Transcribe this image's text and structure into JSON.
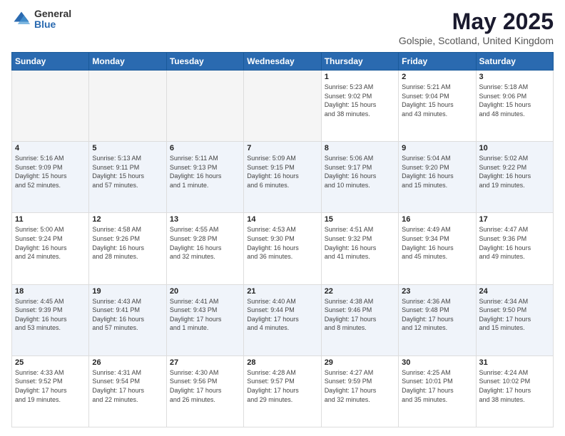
{
  "logo": {
    "general": "General",
    "blue": "Blue"
  },
  "header": {
    "title": "May 2025",
    "subtitle": "Golspie, Scotland, United Kingdom"
  },
  "days_of_week": [
    "Sunday",
    "Monday",
    "Tuesday",
    "Wednesday",
    "Thursday",
    "Friday",
    "Saturday"
  ],
  "weeks": [
    [
      {
        "day": "",
        "info": ""
      },
      {
        "day": "",
        "info": ""
      },
      {
        "day": "",
        "info": ""
      },
      {
        "day": "",
        "info": ""
      },
      {
        "day": "1",
        "info": "Sunrise: 5:23 AM\nSunset: 9:02 PM\nDaylight: 15 hours\nand 38 minutes."
      },
      {
        "day": "2",
        "info": "Sunrise: 5:21 AM\nSunset: 9:04 PM\nDaylight: 15 hours\nand 43 minutes."
      },
      {
        "day": "3",
        "info": "Sunrise: 5:18 AM\nSunset: 9:06 PM\nDaylight: 15 hours\nand 48 minutes."
      }
    ],
    [
      {
        "day": "4",
        "info": "Sunrise: 5:16 AM\nSunset: 9:09 PM\nDaylight: 15 hours\nand 52 minutes."
      },
      {
        "day": "5",
        "info": "Sunrise: 5:13 AM\nSunset: 9:11 PM\nDaylight: 15 hours\nand 57 minutes."
      },
      {
        "day": "6",
        "info": "Sunrise: 5:11 AM\nSunset: 9:13 PM\nDaylight: 16 hours\nand 1 minute."
      },
      {
        "day": "7",
        "info": "Sunrise: 5:09 AM\nSunset: 9:15 PM\nDaylight: 16 hours\nand 6 minutes."
      },
      {
        "day": "8",
        "info": "Sunrise: 5:06 AM\nSunset: 9:17 PM\nDaylight: 16 hours\nand 10 minutes."
      },
      {
        "day": "9",
        "info": "Sunrise: 5:04 AM\nSunset: 9:20 PM\nDaylight: 16 hours\nand 15 minutes."
      },
      {
        "day": "10",
        "info": "Sunrise: 5:02 AM\nSunset: 9:22 PM\nDaylight: 16 hours\nand 19 minutes."
      }
    ],
    [
      {
        "day": "11",
        "info": "Sunrise: 5:00 AM\nSunset: 9:24 PM\nDaylight: 16 hours\nand 24 minutes."
      },
      {
        "day": "12",
        "info": "Sunrise: 4:58 AM\nSunset: 9:26 PM\nDaylight: 16 hours\nand 28 minutes."
      },
      {
        "day": "13",
        "info": "Sunrise: 4:55 AM\nSunset: 9:28 PM\nDaylight: 16 hours\nand 32 minutes."
      },
      {
        "day": "14",
        "info": "Sunrise: 4:53 AM\nSunset: 9:30 PM\nDaylight: 16 hours\nand 36 minutes."
      },
      {
        "day": "15",
        "info": "Sunrise: 4:51 AM\nSunset: 9:32 PM\nDaylight: 16 hours\nand 41 minutes."
      },
      {
        "day": "16",
        "info": "Sunrise: 4:49 AM\nSunset: 9:34 PM\nDaylight: 16 hours\nand 45 minutes."
      },
      {
        "day": "17",
        "info": "Sunrise: 4:47 AM\nSunset: 9:36 PM\nDaylight: 16 hours\nand 49 minutes."
      }
    ],
    [
      {
        "day": "18",
        "info": "Sunrise: 4:45 AM\nSunset: 9:39 PM\nDaylight: 16 hours\nand 53 minutes."
      },
      {
        "day": "19",
        "info": "Sunrise: 4:43 AM\nSunset: 9:41 PM\nDaylight: 16 hours\nand 57 minutes."
      },
      {
        "day": "20",
        "info": "Sunrise: 4:41 AM\nSunset: 9:43 PM\nDaylight: 17 hours\nand 1 minute."
      },
      {
        "day": "21",
        "info": "Sunrise: 4:40 AM\nSunset: 9:44 PM\nDaylight: 17 hours\nand 4 minutes."
      },
      {
        "day": "22",
        "info": "Sunrise: 4:38 AM\nSunset: 9:46 PM\nDaylight: 17 hours\nand 8 minutes."
      },
      {
        "day": "23",
        "info": "Sunrise: 4:36 AM\nSunset: 9:48 PM\nDaylight: 17 hours\nand 12 minutes."
      },
      {
        "day": "24",
        "info": "Sunrise: 4:34 AM\nSunset: 9:50 PM\nDaylight: 17 hours\nand 15 minutes."
      }
    ],
    [
      {
        "day": "25",
        "info": "Sunrise: 4:33 AM\nSunset: 9:52 PM\nDaylight: 17 hours\nand 19 minutes."
      },
      {
        "day": "26",
        "info": "Sunrise: 4:31 AM\nSunset: 9:54 PM\nDaylight: 17 hours\nand 22 minutes."
      },
      {
        "day": "27",
        "info": "Sunrise: 4:30 AM\nSunset: 9:56 PM\nDaylight: 17 hours\nand 26 minutes."
      },
      {
        "day": "28",
        "info": "Sunrise: 4:28 AM\nSunset: 9:57 PM\nDaylight: 17 hours\nand 29 minutes."
      },
      {
        "day": "29",
        "info": "Sunrise: 4:27 AM\nSunset: 9:59 PM\nDaylight: 17 hours\nand 32 minutes."
      },
      {
        "day": "30",
        "info": "Sunrise: 4:25 AM\nSunset: 10:01 PM\nDaylight: 17 hours\nand 35 minutes."
      },
      {
        "day": "31",
        "info": "Sunrise: 4:24 AM\nSunset: 10:02 PM\nDaylight: 17 hours\nand 38 minutes."
      }
    ]
  ]
}
